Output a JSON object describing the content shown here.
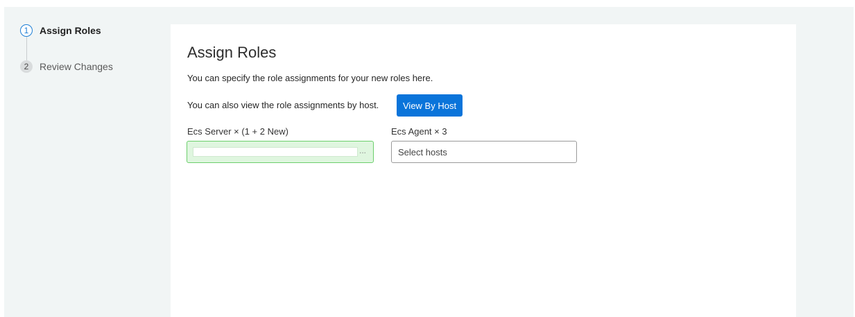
{
  "stepper": {
    "steps": [
      {
        "number": "1",
        "label": "Assign Roles",
        "state": "active"
      },
      {
        "number": "2",
        "label": "Review Changes",
        "state": "inactive"
      }
    ]
  },
  "main": {
    "title": "Assign Roles",
    "description": "You can specify the role assignments for your new roles here.",
    "view_by_host_text": "You can also view the role assignments by host.",
    "view_by_host_button": "View By Host",
    "roles": [
      {
        "label": "Ecs Server × (1 + 2 New)",
        "field_ellipsis": "..."
      },
      {
        "label": "Ecs Agent × 3",
        "placeholder": "Select hosts"
      }
    ]
  },
  "colors": {
    "accent": "#0a74da",
    "active_step": "#1e7fd6",
    "valid_border": "#6ccf6c",
    "valid_fill": "#dff6df",
    "background": "#f1f5f5"
  }
}
